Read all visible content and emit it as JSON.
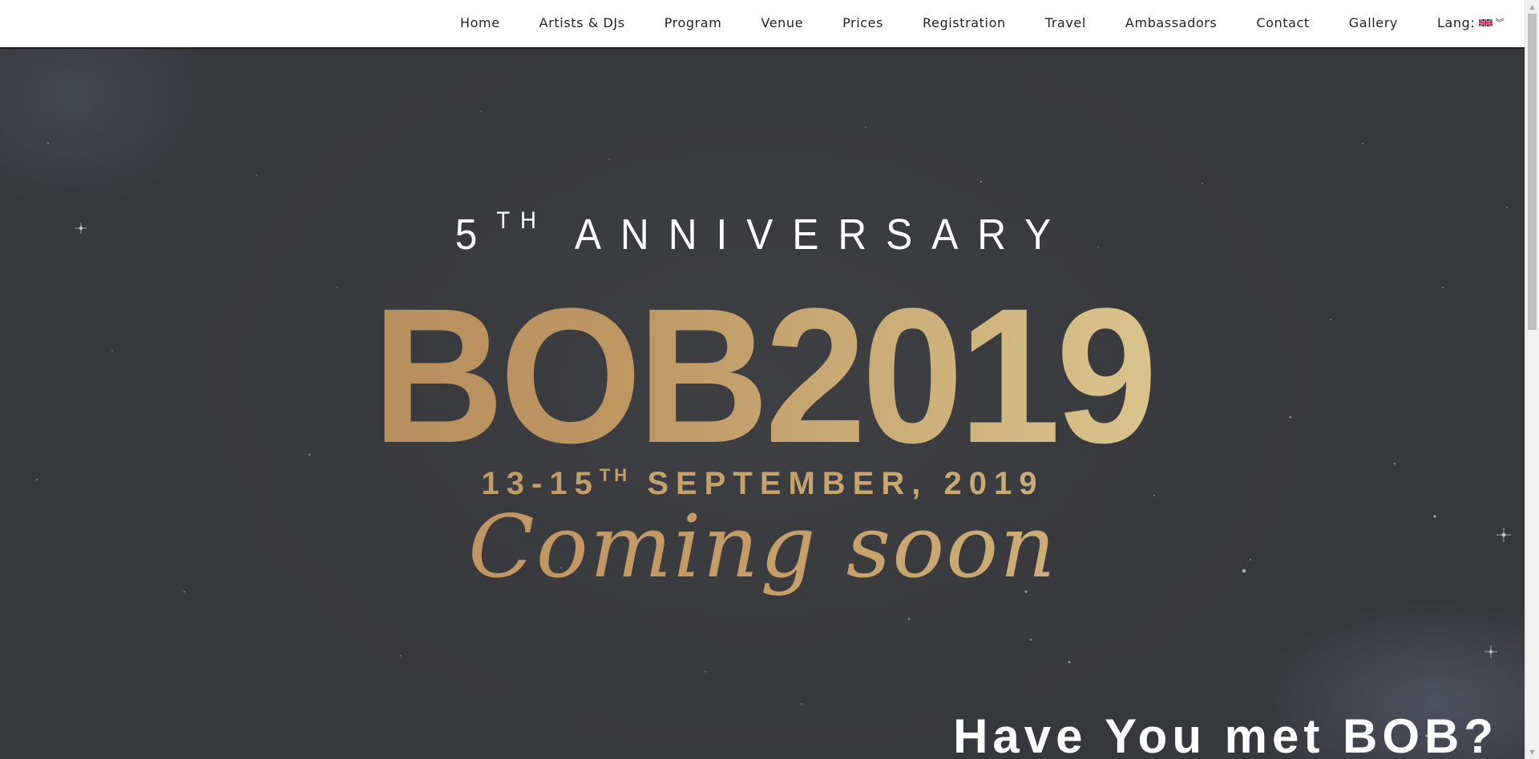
{
  "nav": {
    "items": [
      {
        "label": "Home"
      },
      {
        "label": "Artists & DJs"
      },
      {
        "label": "Program"
      },
      {
        "label": "Venue"
      },
      {
        "label": "Prices"
      },
      {
        "label": "Registration"
      },
      {
        "label": "Travel"
      },
      {
        "label": "Ambassadors"
      },
      {
        "label": "Contact"
      },
      {
        "label": "Gallery"
      }
    ],
    "lang_label": "Lang:",
    "lang_flag_icon": "uk-flag-icon",
    "lang_dropdown_icon": "double-chevron-down-icon"
  },
  "hero": {
    "anniversary_number": "5",
    "anniversary_suffix": "TH",
    "anniversary_word": "ANNIVERSARY",
    "title": "BOB2019",
    "dates_main": "13-15",
    "dates_suffix": "TH",
    "dates_rest": "SEPTEMBER, 2019",
    "tagline": "Coming soon",
    "section_heading": "Have You met BOB?"
  },
  "colors": {
    "nav_bg": "#ffffff",
    "nav_text": "#222222",
    "hero_bg": "#3a3b3f",
    "gold_dark": "#b1875a",
    "gold_light": "#ddc991",
    "white": "#ffffff"
  }
}
